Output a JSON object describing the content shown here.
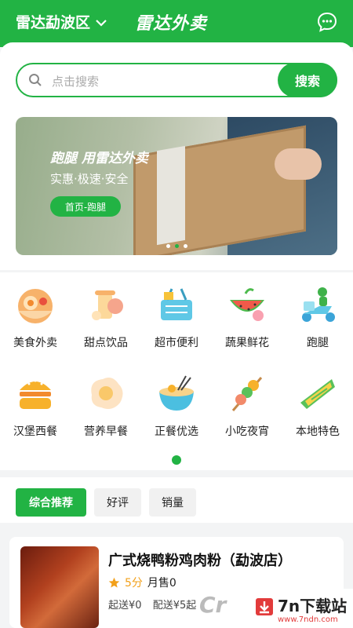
{
  "header": {
    "location": "雷达勐波区",
    "app_title": "雷达外卖"
  },
  "search": {
    "placeholder": "点击搜索",
    "button_label": "搜索"
  },
  "banner": {
    "headline": "跑腿  用雷达外卖",
    "subline": "实惠·极速·安全",
    "cta": "首页-跑腿",
    "slide_count": 3,
    "active_slide": 2
  },
  "categories": [
    {
      "label": "美食外卖",
      "icon": "food-delivery-icon"
    },
    {
      "label": "甜点饮品",
      "icon": "dessert-drink-icon"
    },
    {
      "label": "超市便利",
      "icon": "supermarket-basket-icon"
    },
    {
      "label": "蔬果鲜花",
      "icon": "fruit-flower-icon"
    },
    {
      "label": "跑腿",
      "icon": "courier-scooter-icon"
    },
    {
      "label": "汉堡西餐",
      "icon": "burger-icon"
    },
    {
      "label": "营养早餐",
      "icon": "fried-egg-icon"
    },
    {
      "label": "正餐优选",
      "icon": "noodle-bowl-icon"
    },
    {
      "label": "小吃夜宵",
      "icon": "skewer-icon"
    },
    {
      "label": "本地特色",
      "icon": "local-food-icon"
    }
  ],
  "filters": [
    {
      "label": "综合推荐",
      "active": true
    },
    {
      "label": "好评",
      "active": false
    },
    {
      "label": "销量",
      "active": false
    }
  ],
  "store": {
    "name": "广式烧鸭粉鸡肉粉（勐波店）",
    "score": "5分",
    "monthly_sales": "月售0",
    "min_order": "起送¥0",
    "delivery_fee": "配送¥5起"
  },
  "watermark": {
    "title": "7n下载站",
    "url": "www.7ndn.com"
  },
  "colors": {
    "brand_green": "#22b344",
    "star": "#f2a01a"
  }
}
